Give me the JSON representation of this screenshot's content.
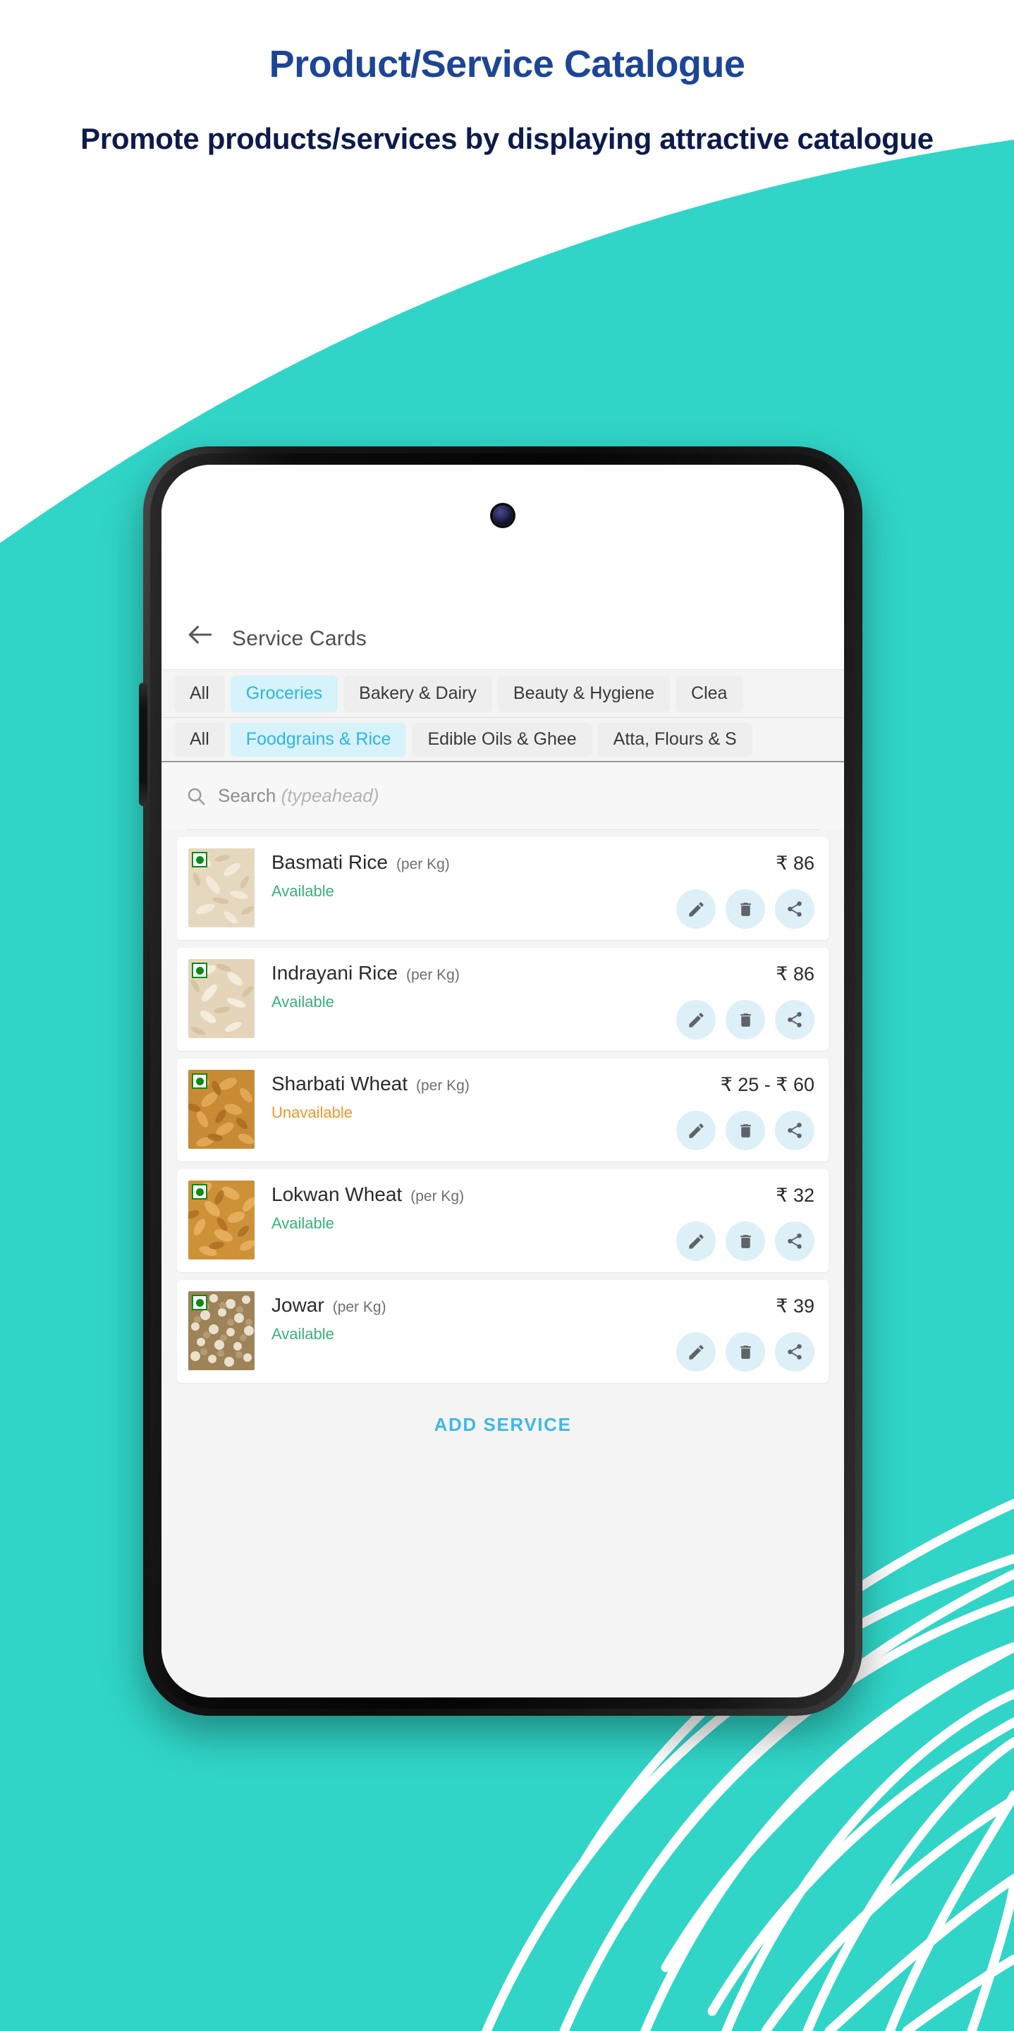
{
  "promo": {
    "title": "Product/Service Catalogue",
    "subtitle": "Promote products/services by displaying attractive catalogue"
  },
  "theme": {
    "teal": "#30d5c8",
    "teal_dark": "#23c3bd",
    "headline_blue": "#1d4596",
    "sub_navy": "#0d1b4c",
    "accent_cyan": "#41b8e6",
    "chip_active_bg": "#d6f2fa",
    "chip_active_text": "#2eb5e8",
    "available_green": "#36b37a",
    "unavailable_orange": "#f0952d",
    "action_bubble": "#ddf0f7"
  },
  "app": {
    "back_icon": "arrow-left-icon",
    "title": "Service Cards",
    "category_tabs": [
      {
        "label": "All",
        "active": false
      },
      {
        "label": "Groceries",
        "active": true
      },
      {
        "label": "Bakery & Dairy",
        "active": false
      },
      {
        "label": "Beauty & Hygiene",
        "active": false
      },
      {
        "label": "Clea",
        "active": false
      }
    ],
    "subcategory_tabs": [
      {
        "label": "All",
        "active": false
      },
      {
        "label": "Foodgrains & Rice",
        "active": true
      },
      {
        "label": "Edible Oils & Ghee",
        "active": false
      },
      {
        "label": "Atta, Flours & S",
        "active": false
      }
    ],
    "search": {
      "icon": "search-icon",
      "label": "Search",
      "hint": "(typeahead)"
    },
    "items": [
      {
        "name": "Basmati Rice",
        "unit": "(per Kg)",
        "status": "Available",
        "available": true,
        "price": "₹ 86",
        "thumb": "rice-grains",
        "veg": true
      },
      {
        "name": "Indrayani Rice",
        "unit": "(per Kg)",
        "status": "Available",
        "available": true,
        "price": "₹ 86",
        "thumb": "rice-grains",
        "veg": true
      },
      {
        "name": "Sharbati Wheat",
        "unit": "(per Kg)",
        "status": "Unavailable",
        "available": false,
        "price": "₹ 25 - ₹ 60",
        "thumb": "wheat-grains",
        "veg": true
      },
      {
        "name": "Lokwan Wheat",
        "unit": "(per Kg)",
        "status": "Available",
        "available": true,
        "price": "₹ 32",
        "thumb": "wheat-grains",
        "veg": true
      },
      {
        "name": "Jowar",
        "unit": "(per Kg)",
        "status": "Available",
        "available": true,
        "price": "₹ 39",
        "thumb": "jowar-grains",
        "veg": true
      }
    ],
    "row_actions": [
      {
        "icon": "edit-pencil-icon",
        "name": "edit"
      },
      {
        "icon": "trash-icon",
        "name": "delete"
      },
      {
        "icon": "share-icon",
        "name": "share"
      }
    ],
    "add_service_label": "ADD SERVICE"
  }
}
